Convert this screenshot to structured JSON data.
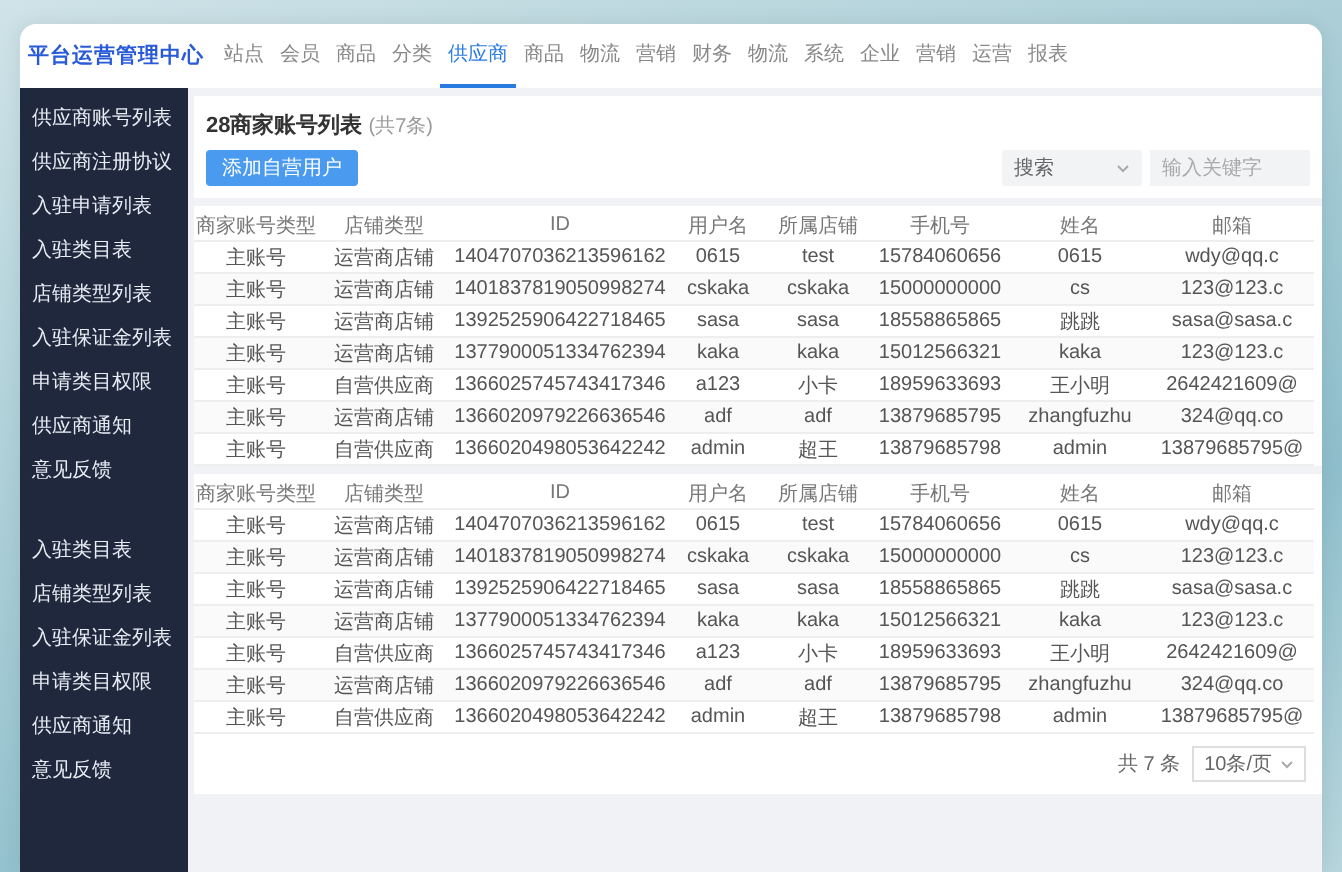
{
  "app": {
    "title": "平台运营管理中心"
  },
  "tabs": [
    {
      "label": "站点",
      "selected": false
    },
    {
      "label": "会员",
      "selected": false
    },
    {
      "label": "商品",
      "selected": false
    },
    {
      "label": "分类",
      "selected": false
    },
    {
      "label": "供应商",
      "selected": true
    },
    {
      "label": "商品",
      "selected": false
    },
    {
      "label": "物流",
      "selected": false
    },
    {
      "label": "营销",
      "selected": false
    },
    {
      "label": "财务",
      "selected": false
    },
    {
      "label": "物流",
      "selected": false
    },
    {
      "label": "系统",
      "selected": false
    },
    {
      "label": "企业",
      "selected": false
    },
    {
      "label": "营销",
      "selected": false
    },
    {
      "label": "运营",
      "selected": false
    },
    {
      "label": "报表",
      "selected": false
    }
  ],
  "sidebar": {
    "groups": [
      {
        "items": [
          "供应商账号列表",
          "供应商注册协议",
          "入驻申请列表",
          "入驻类目表",
          "店铺类型列表",
          "入驻保证金列表",
          "申请类目权限",
          "供应商通知",
          "意见反馈"
        ]
      },
      {
        "items": [
          "入驻类目表",
          "店铺类型列表",
          "入驻保证金列表",
          "申请类目权限",
          "供应商通知",
          "意见反馈"
        ]
      }
    ]
  },
  "page": {
    "title": "28商家账号列表",
    "count": "(共7条)",
    "add_button": "添加自营用户",
    "search_select": "搜索",
    "search": {
      "placeholder": "输入关键字"
    }
  },
  "tables": [
    {
      "columns": [
        "商家账号类型",
        "店铺类型",
        "ID",
        "用户名",
        "所属店铺",
        "手机号",
        "姓名",
        "邮箱"
      ],
      "rows": [
        [
          "主账号",
          "运营商店铺",
          "1404707036213596162",
          "0615",
          "test",
          "15784060656",
          "0615",
          "wdy@qq.c"
        ],
        [
          "主账号",
          "运营商店铺",
          "1401837819050998274",
          "cskaka",
          "cskaka",
          "15000000000",
          "cs",
          "123@123.c"
        ],
        [
          "主账号",
          "运营商店铺",
          "1392525906422718465",
          "sasa",
          "sasa",
          "18558865865",
          "跳跳",
          "sasa@sasa.c"
        ],
        [
          "主账号",
          "运营商店铺",
          "1377900051334762394",
          "kaka",
          "kaka",
          "15012566321",
          "kaka",
          "123@123.c"
        ],
        [
          "主账号",
          "自营供应商",
          "1366025745743417346",
          "a123",
          "小卡",
          "18959633693",
          "王小明",
          "2642421609@"
        ],
        [
          "主账号",
          "运营商店铺",
          "1366020979226636546",
          "adf",
          "adf",
          "13879685795",
          "zhangfuzhu",
          "324@qq.co"
        ],
        [
          "主账号",
          "自营供应商",
          "1366020498053642242",
          "admin",
          "超王",
          "13879685798",
          "admin",
          "13879685795@"
        ]
      ]
    },
    {
      "columns": [
        "商家账号类型",
        "店铺类型",
        "ID",
        "用户名",
        "所属店铺",
        "手机号",
        "姓名",
        "邮箱"
      ],
      "rows": [
        [
          "主账号",
          "运营商店铺",
          "1404707036213596162",
          "0615",
          "test",
          "15784060656",
          "0615",
          "wdy@qq.c"
        ],
        [
          "主账号",
          "运营商店铺",
          "1401837819050998274",
          "cskaka",
          "cskaka",
          "15000000000",
          "cs",
          "123@123.c"
        ],
        [
          "主账号",
          "运营商店铺",
          "1392525906422718465",
          "sasa",
          "sasa",
          "18558865865",
          "跳跳",
          "sasa@sasa.c"
        ],
        [
          "主账号",
          "运营商店铺",
          "1377900051334762394",
          "kaka",
          "kaka",
          "15012566321",
          "kaka",
          "123@123.c"
        ],
        [
          "主账号",
          "自营供应商",
          "1366025745743417346",
          "a123",
          "小卡",
          "18959633693",
          "王小明",
          "2642421609@"
        ],
        [
          "主账号",
          "运营商店铺",
          "1366020979226636546",
          "adf",
          "adf",
          "13879685795",
          "zhangfuzhu",
          "324@qq.co"
        ],
        [
          "主账号",
          "自营供应商",
          "1366020498053642242",
          "admin",
          "超王",
          "13879685798",
          "admin",
          "13879685795@"
        ]
      ]
    }
  ],
  "pagination": {
    "total": "共 7 条",
    "page_size": "10条/页"
  }
}
